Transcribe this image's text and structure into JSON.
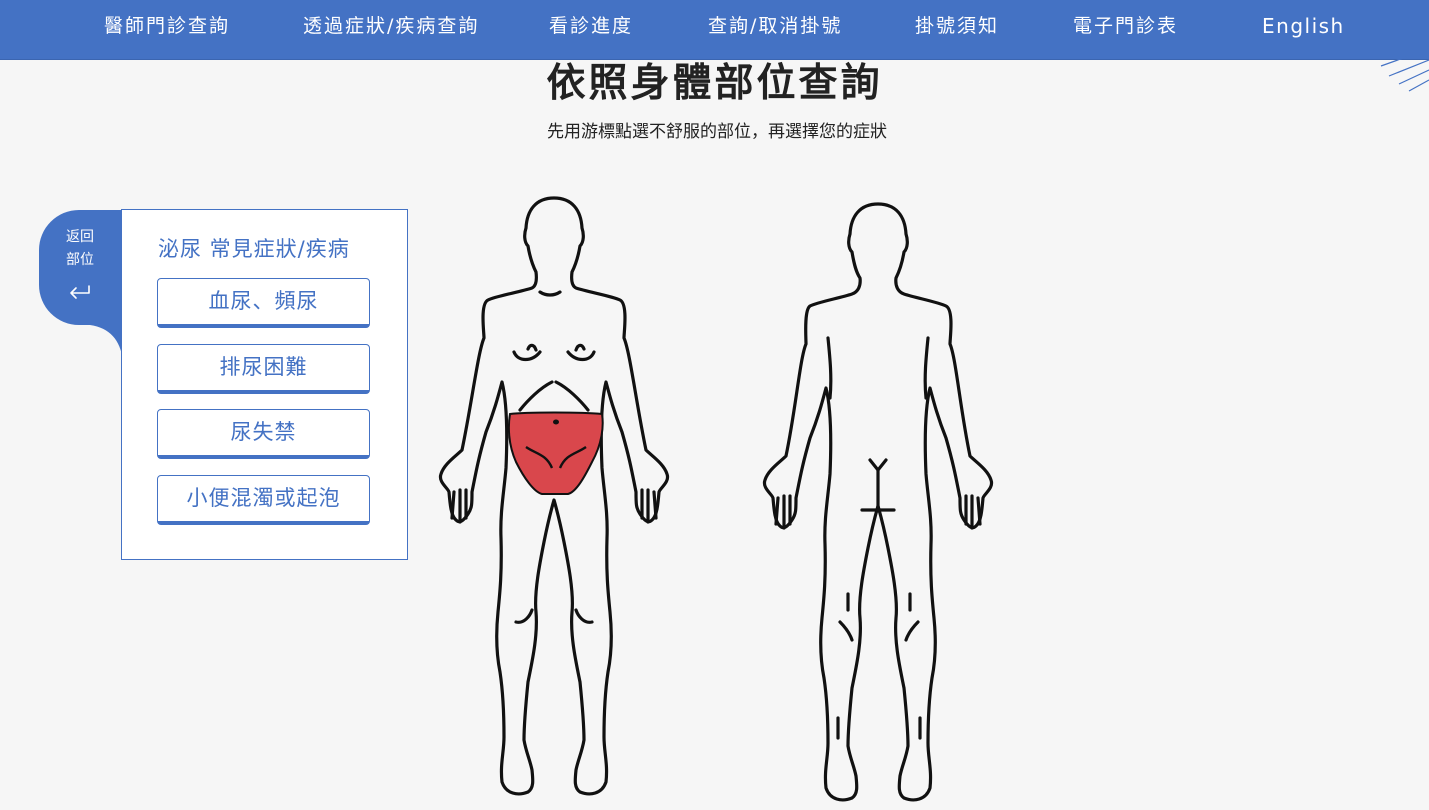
{
  "nav": {
    "items": [
      {
        "label": "醫師門診查詢"
      },
      {
        "label": "透過症狀/疾病查詢"
      },
      {
        "label": "看診進度"
      },
      {
        "label": "查詢/取消掛號"
      },
      {
        "label": "掛號須知"
      },
      {
        "label": "電子門診表"
      },
      {
        "label": "English"
      }
    ]
  },
  "heading": {
    "title": "依照身體部位查詢",
    "subtitle": "先用游標點選不舒服的部位，再選擇您的症狀"
  },
  "back": {
    "label_line1": "返回",
    "label_line2": "部位",
    "icon": "return-arrow-icon"
  },
  "panel": {
    "title": "泌尿 常見症狀/疾病",
    "symptoms": [
      {
        "label": "血尿、頻尿"
      },
      {
        "label": "排尿困難"
      },
      {
        "label": "尿失禁"
      },
      {
        "label": "小便混濁或起泡"
      }
    ]
  },
  "body_map": {
    "selected_region": "pelvis",
    "highlight_color": "#d9474c"
  },
  "colors": {
    "primary": "#4472c4",
    "background": "#f6f6f6",
    "highlight": "#d9474c"
  }
}
